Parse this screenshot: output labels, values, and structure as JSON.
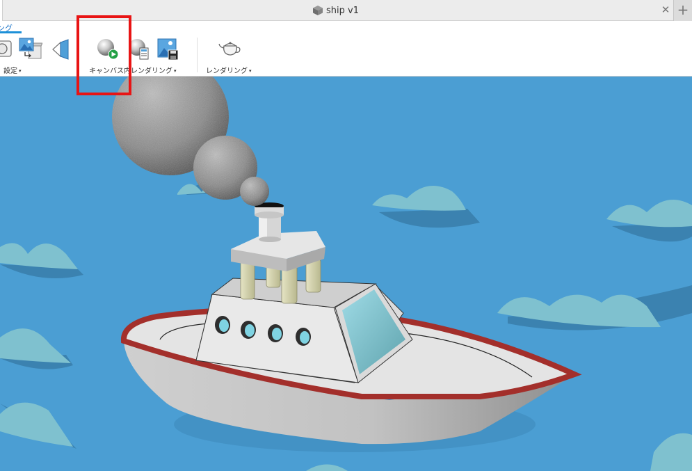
{
  "window": {
    "document_title": "ship v1",
    "close_glyph": "✕",
    "add_glyph": "+"
  },
  "toolbar": {
    "active_tab_label": "ング",
    "groups": [
      {
        "label": "設定",
        "caret": "▾"
      },
      {
        "label": "キャンバス内レンダリング",
        "caret": "▾"
      },
      {
        "label": "レンダリング",
        "caret": "▾"
      }
    ],
    "buttons": [
      {
        "icon": "scene-settings-icon"
      },
      {
        "icon": "environment-library-icon"
      },
      {
        "icon": "texture-map-icon"
      },
      {
        "icon": "start-in-canvas-render-icon",
        "highlighted": true
      },
      {
        "icon": "in-canvas-render-settings-icon"
      },
      {
        "icon": "capture-image-icon"
      },
      {
        "icon": "render-teapot-icon"
      }
    ]
  },
  "viewport": {
    "scene": "ship-model-render",
    "background_color": "#4b9ed3",
    "wave_color": "#7fc1cf"
  },
  "highlight": {
    "color": "#e81414"
  }
}
